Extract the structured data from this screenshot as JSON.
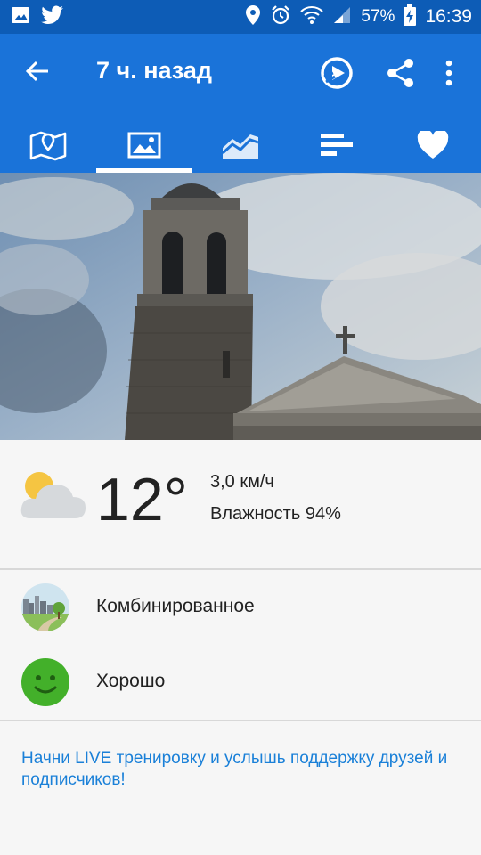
{
  "status_bar": {
    "battery": "57%",
    "time": "16:39",
    "icons": [
      "image-icon",
      "twitter-icon",
      "location-icon",
      "alarm-icon",
      "wifi-icon",
      "signal-icon",
      "battery-icon"
    ]
  },
  "app_bar": {
    "title": "7 ч. назад",
    "actions": [
      "play-movie-icon",
      "share-icon",
      "more-icon"
    ]
  },
  "tabs": [
    {
      "name": "map",
      "icon": "map-icon",
      "active": false
    },
    {
      "name": "photo",
      "icon": "photo-icon",
      "active": true
    },
    {
      "name": "chart",
      "icon": "chart-icon",
      "active": false
    },
    {
      "name": "laps",
      "icon": "laps-icon",
      "active": false
    },
    {
      "name": "likes",
      "icon": "heart-icon",
      "active": false
    }
  ],
  "weather": {
    "temperature": "12°",
    "wind": "3,0 км/ч",
    "humidity": "Влажность 94%",
    "icon": "partly-cloudy-icon"
  },
  "terrain": {
    "label": "Комбинированное",
    "icon": "terrain-icon"
  },
  "feeling": {
    "label": "Хорошо",
    "icon": "smiley-icon"
  },
  "live_text": "Начни LIVE тренировку и услышь поддержку друзей и подписчиков!",
  "colors": {
    "status_bar": "#0d5cb6",
    "app_bar": "#1a73d9",
    "link": "#1a80d8",
    "feeling": "#43b02a"
  }
}
